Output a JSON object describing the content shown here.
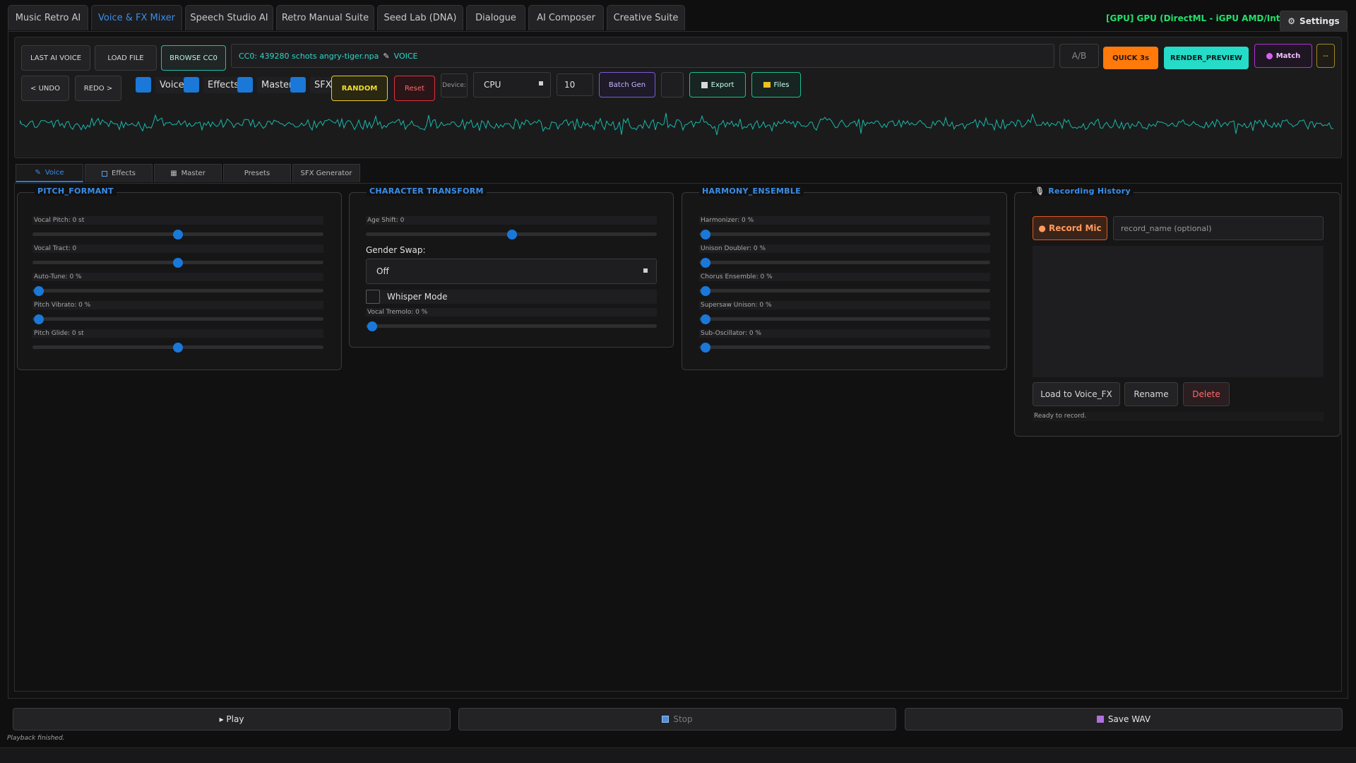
{
  "top_tabs": [
    {
      "label": "Music Retro AI"
    },
    {
      "label": "Voice & FX Mixer"
    },
    {
      "label": "Speech Studio AI"
    },
    {
      "label": "Retro Manual Suite"
    },
    {
      "label": "Seed Lab (DNA)"
    },
    {
      "label": "Dialogue"
    },
    {
      "label": "AI Composer"
    },
    {
      "label": "Creative Suite"
    }
  ],
  "active_top_tab": "Voice & FX Mixer",
  "gpu_status": "[GPU] GPU (DirectML - iGPU AMD/Intel)",
  "settings_label": "Settings",
  "toolbar": {
    "last_ai_voice": "LAST AI VOICE",
    "load_file": "LOAD FILE",
    "browse_cc0": "BROWSE CC0",
    "loaded_file": "CC0: 439280 schots angry-tiger.npa",
    "loaded_tag": "VOICE",
    "ab": "A/B",
    "quick": "QUICK 3s",
    "render_preview": "RENDER_PREVIEW",
    "match": "Match",
    "more": "--",
    "undo": "< UNDO",
    "redo": "REDO >",
    "checks": [
      {
        "label": "Voice",
        "checked": true
      },
      {
        "label": "Effects",
        "checked": true
      },
      {
        "label": "Master",
        "checked": true
      },
      {
        "label": "SFX",
        "checked": true
      }
    ],
    "random": "RANDOM",
    "reset": "Reset",
    "device_label": "Device:",
    "device_value": "CPU",
    "batch_count": "10",
    "batch_gen": "Batch Gen",
    "export": "Export",
    "files": "Files"
  },
  "sub_tabs": [
    {
      "label": "Voice",
      "icon": "mic-icon"
    },
    {
      "label": "Effects",
      "icon": "effects-icon"
    },
    {
      "label": "Master",
      "icon": "grid-icon"
    },
    {
      "label": "Presets",
      "icon": ""
    },
    {
      "label": "SFX Generator",
      "icon": ""
    }
  ],
  "panels": {
    "pitch_formant": {
      "title": "PITCH_FORMANT",
      "sliders": [
        {
          "label": "Vocal Pitch: 0 st",
          "fraction": 0.5
        },
        {
          "label": "Vocal Tract: 0",
          "fraction": 0.5
        },
        {
          "label": "Auto-Tune: 0 %",
          "fraction": 0.0
        },
        {
          "label": "Pitch Vibrato: 0 %",
          "fraction": 0.0
        },
        {
          "label": "Pitch Glide: 0 st",
          "fraction": 0.5
        }
      ]
    },
    "character_transform": {
      "title": "CHARACTER TRANSFORM",
      "age_shift": {
        "label": "Age Shift: 0",
        "fraction": 0.5
      },
      "gender_swap_label": "Gender Swap:",
      "gender_swap_value": "Off",
      "whisper_label": "Whisper Mode",
      "whisper_checked": false,
      "vocal_tremolo": {
        "label": "Vocal Tremolo: 0 %",
        "fraction": 0.0
      }
    },
    "harmony_ensemble": {
      "title": "HARMONY_ENSEMBLE",
      "sliders": [
        {
          "label": "Harmonizer: 0 %",
          "fraction": 0.0
        },
        {
          "label": "Unison Doubler: 0 %",
          "fraction": 0.0
        },
        {
          "label": "Chorus Ensemble: 0 %",
          "fraction": 0.0
        },
        {
          "label": "Supersaw Unison: 0 %",
          "fraction": 0.0
        },
        {
          "label": "Sub-Oscillator: 0 %",
          "fraction": 0.0
        }
      ]
    },
    "recording_history": {
      "title": "Recording History",
      "record_mic": "● Record Mic",
      "name_placeholder": "record_name (optional)",
      "load_to_voice": "Load to Voice_FX",
      "rename": "Rename",
      "delete": "Delete",
      "status": "Ready to record."
    }
  },
  "transport": {
    "play": "▸ Play",
    "stop": "Stop",
    "save_wav": "Save WAV"
  },
  "footer_status": "Playback finished.",
  "colors": {
    "accent_blue": "#3a8ee8",
    "teal": "#1fbfae",
    "orange": "#ff7a0a",
    "gpu_green": "#22e06a"
  }
}
